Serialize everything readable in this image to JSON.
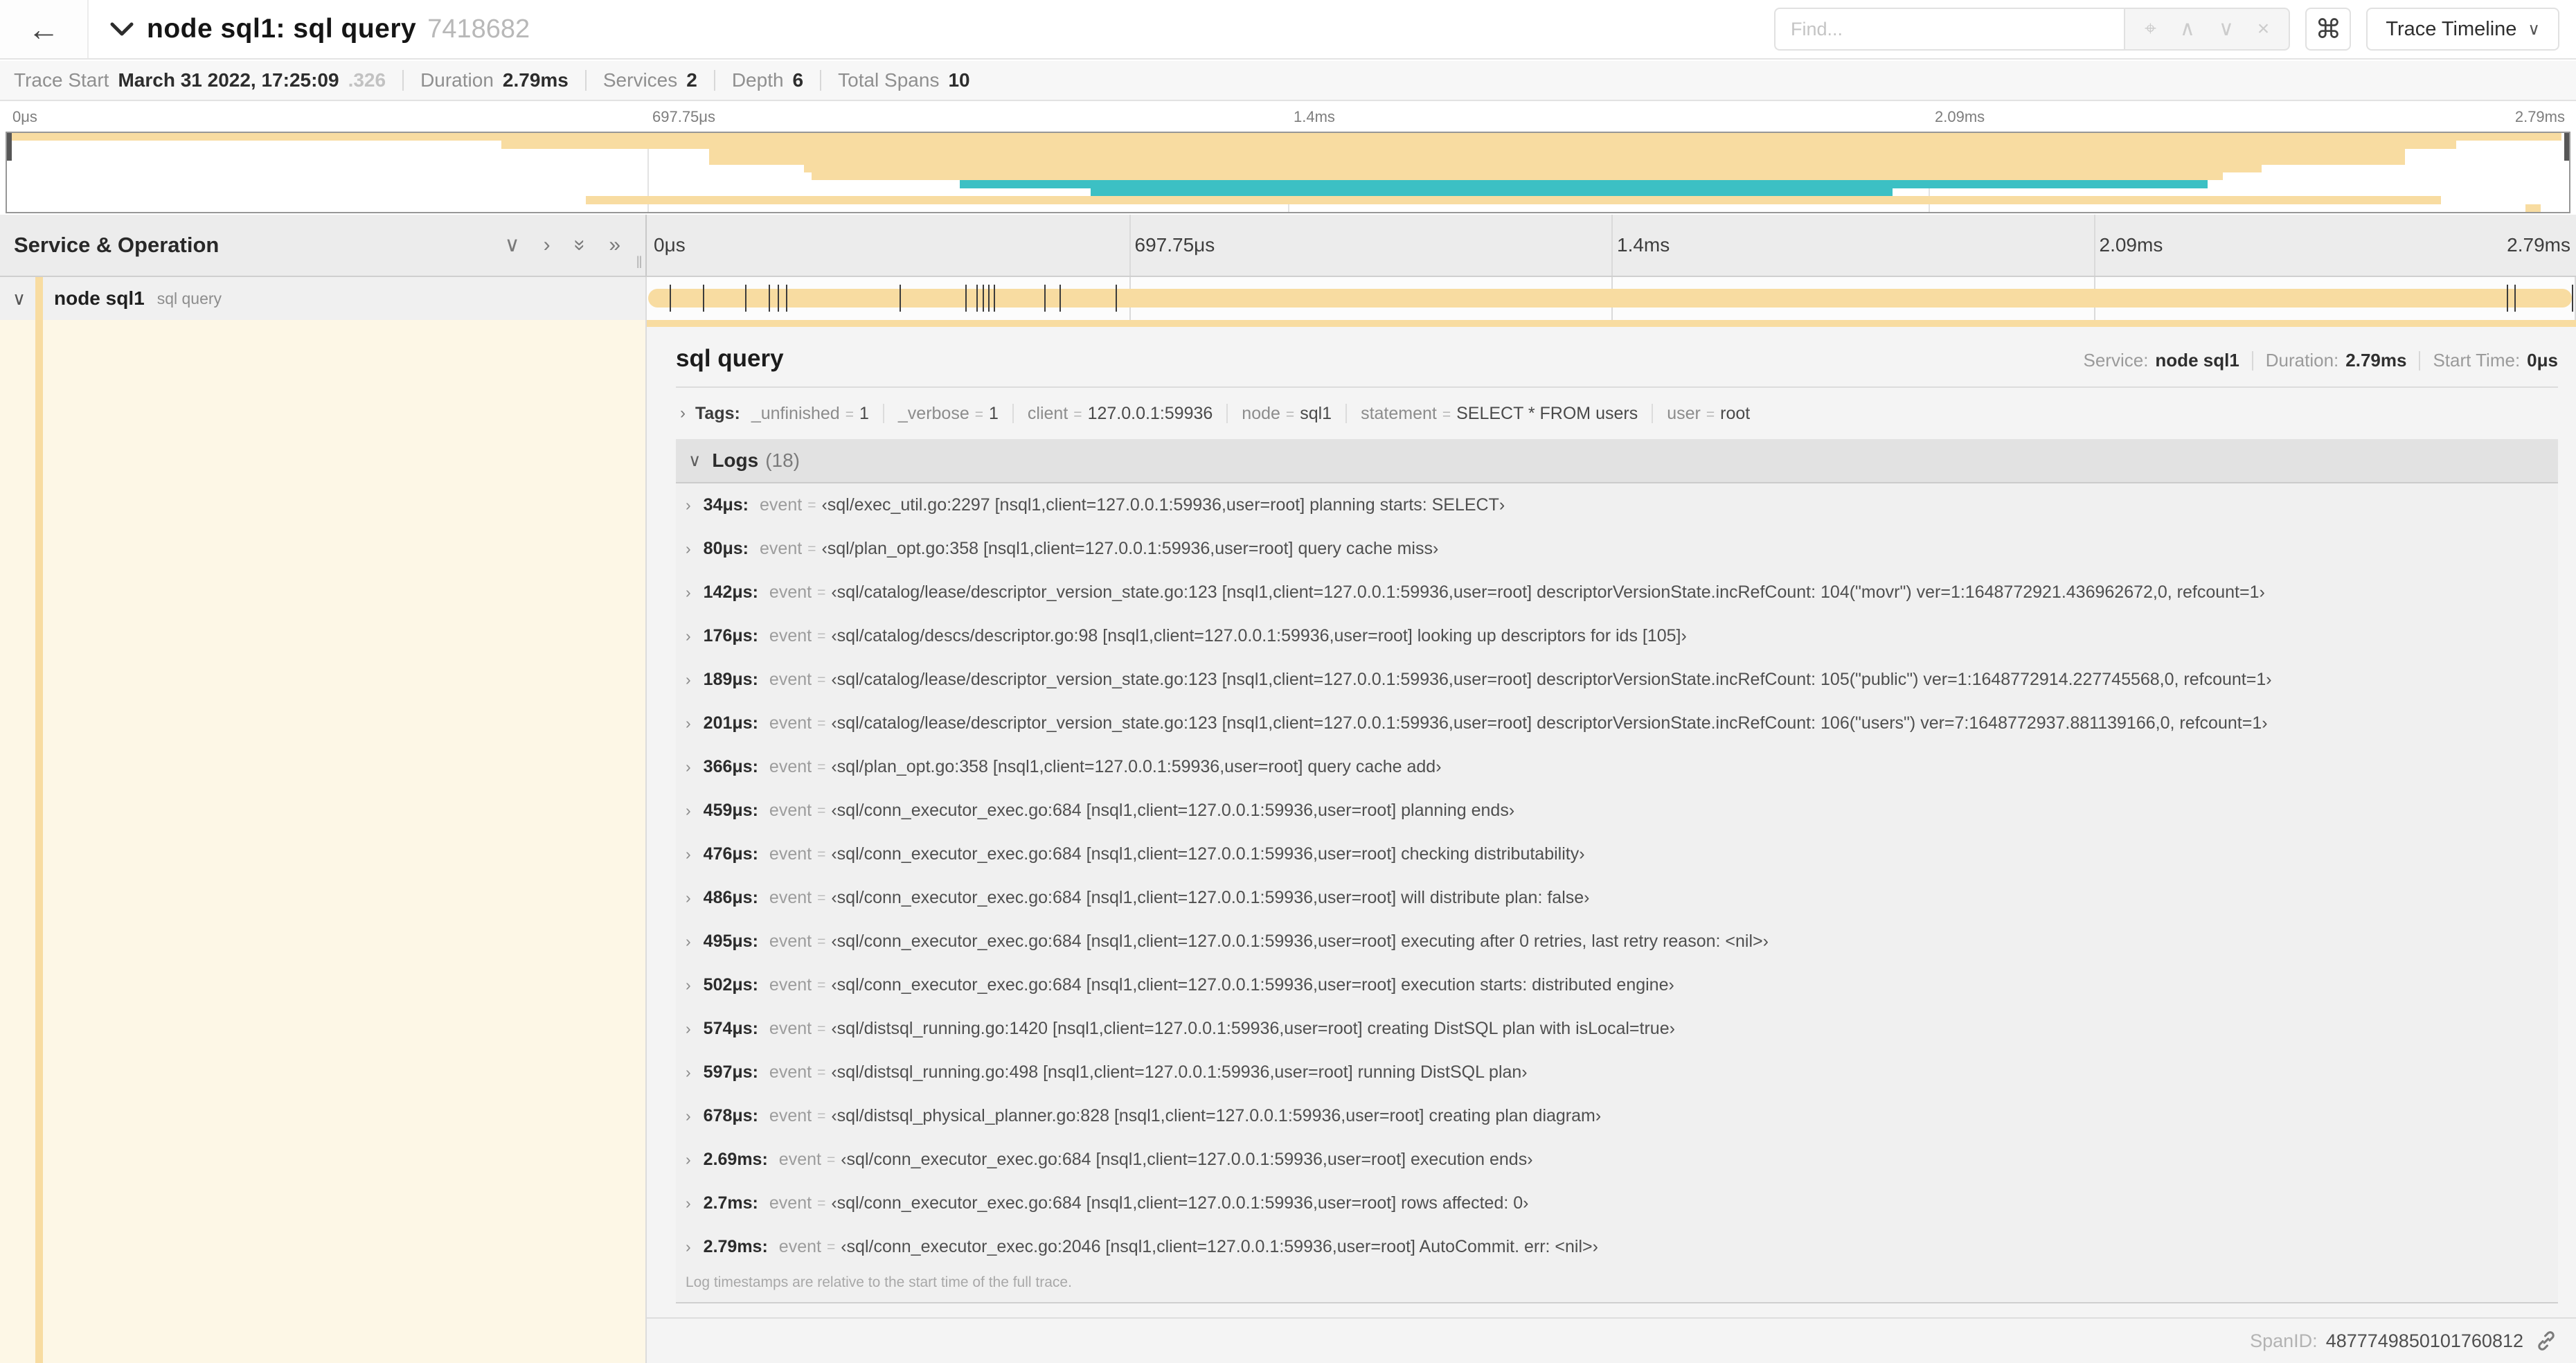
{
  "header": {
    "back_glyph": "←",
    "title": "node sql1: sql query",
    "trace_id": "7418682",
    "find_placeholder": "Find...",
    "find_icons": [
      {
        "name": "locate-icon",
        "glyph": "⌖"
      },
      {
        "name": "prev-match-icon",
        "glyph": "∧"
      },
      {
        "name": "next-match-icon",
        "glyph": "∨"
      },
      {
        "name": "clear-find-icon",
        "glyph": "×"
      }
    ],
    "shortcut_glyph": "⌘",
    "view_button_label": "Trace Timeline",
    "view_button_caret": "∨"
  },
  "summary": {
    "items": [
      {
        "label": "Trace Start",
        "value": "March 31 2022, 17:25:09",
        "suffix": ".326"
      },
      {
        "label": "Duration",
        "value": "2.79ms"
      },
      {
        "label": "Services",
        "value": "2"
      },
      {
        "label": "Depth",
        "value": "6"
      },
      {
        "label": "Total Spans",
        "value": "10"
      }
    ]
  },
  "colors": {
    "tan": "#F8DCA1",
    "teal": "#3CC0C4"
  },
  "minimap": {
    "ticks": [
      "0μs",
      "697.75μs",
      "1.4ms",
      "2.09ms",
      "2.79ms"
    ],
    "tick_pcts": [
      0,
      25,
      50,
      75,
      100
    ],
    "spans": [
      {
        "start": 0,
        "end": 99.7,
        "color": "tan"
      },
      {
        "start": 19.3,
        "end": 95.6,
        "color": "tan"
      },
      {
        "start": 27.4,
        "end": 93.6,
        "color": "tan"
      },
      {
        "start": 27.4,
        "end": 93.6,
        "color": "tan"
      },
      {
        "start": 31.1,
        "end": 88.0,
        "color": "tan"
      },
      {
        "start": 31.4,
        "end": 86.5,
        "color": "tan"
      },
      {
        "start": 37.2,
        "end": 85.9,
        "color": "teal"
      },
      {
        "start": 42.3,
        "end": 73.6,
        "color": "teal"
      },
      {
        "start": 22.6,
        "end": 95.0,
        "color": "tan"
      },
      {
        "start": 98.3,
        "end": 98.9,
        "color": "tan"
      }
    ]
  },
  "timeline": {
    "header_title": "Service & Operation",
    "header_icons": [
      {
        "name": "expand-one-icon",
        "glyph": "∨",
        "rot": false
      },
      {
        "name": "collapse-one-icon",
        "glyph": "›",
        "rot": false
      },
      {
        "name": "expand-all-icon",
        "glyph": "»",
        "rot": true
      },
      {
        "name": "collapse-all-icon",
        "glyph": "»",
        "rot": false
      }
    ],
    "resizer_glyph": "‖",
    "ticks": [
      "0μs",
      "697.75μs",
      "1.4ms",
      "2.09ms",
      "2.79ms"
    ],
    "tick_pcts": [
      0,
      25,
      50,
      75,
      100
    ],
    "row": {
      "service": "node sql1",
      "operation": "sql query",
      "chevron": "∨",
      "color": "tan"
    },
    "log_marker_pcts": [
      1.2,
      2.9,
      5.1,
      6.3,
      6.8,
      7.2,
      13.1,
      16.5,
      17.1,
      17.4,
      17.7,
      18.0,
      20.6,
      21.4,
      24.3,
      96.4,
      96.8,
      99.8
    ]
  },
  "detail": {
    "operation": "sql query",
    "meta": [
      {
        "label": "Service:",
        "value": "node sql1"
      },
      {
        "label": "Duration:",
        "value": "2.79ms"
      },
      {
        "label": "Start Time:",
        "value": "0μs"
      }
    ],
    "tags_label": "Tags:",
    "tags": [
      {
        "key": "_unfinished",
        "value": "1"
      },
      {
        "key": "_verbose",
        "value": "1"
      },
      {
        "key": "client",
        "value": "127.0.0.1:59936"
      },
      {
        "key": "node",
        "value": "sql1"
      },
      {
        "key": "statement",
        "value": "SELECT * FROM users"
      },
      {
        "key": "user",
        "value": "root"
      }
    ],
    "logs": {
      "title": "Logs",
      "count": "(18)",
      "field": "event",
      "entries": [
        {
          "time": "34μs",
          "value": "sql/exec_util.go:2297 [nsql1,client=127.0.0.1:59936,user=root] planning starts: SELECT"
        },
        {
          "time": "80μs",
          "value": "sql/plan_opt.go:358 [nsql1,client=127.0.0.1:59936,user=root] query cache miss"
        },
        {
          "time": "142μs",
          "value": "sql/catalog/lease/descriptor_version_state.go:123 [nsql1,client=127.0.0.1:59936,user=root] descriptorVersionState.incRefCount: 104(\"movr\") ver=1:1648772921.436962672,0, refcount=1"
        },
        {
          "time": "176μs",
          "value": "sql/catalog/descs/descriptor.go:98 [nsql1,client=127.0.0.1:59936,user=root] looking up descriptors for ids [105]"
        },
        {
          "time": "189μs",
          "value": "sql/catalog/lease/descriptor_version_state.go:123 [nsql1,client=127.0.0.1:59936,user=root] descriptorVersionState.incRefCount: 105(\"public\") ver=1:1648772914.227745568,0, refcount=1"
        },
        {
          "time": "201μs",
          "value": "sql/catalog/lease/descriptor_version_state.go:123 [nsql1,client=127.0.0.1:59936,user=root] descriptorVersionState.incRefCount: 106(\"users\") ver=7:1648772937.881139166,0, refcount=1"
        },
        {
          "time": "366μs",
          "value": "sql/plan_opt.go:358 [nsql1,client=127.0.0.1:59936,user=root] query cache add"
        },
        {
          "time": "459μs",
          "value": "sql/conn_executor_exec.go:684 [nsql1,client=127.0.0.1:59936,user=root] planning ends"
        },
        {
          "time": "476μs",
          "value": "sql/conn_executor_exec.go:684 [nsql1,client=127.0.0.1:59936,user=root] checking distributability"
        },
        {
          "time": "486μs",
          "value": "sql/conn_executor_exec.go:684 [nsql1,client=127.0.0.1:59936,user=root] will distribute plan: false"
        },
        {
          "time": "495μs",
          "value": "sql/conn_executor_exec.go:684 [nsql1,client=127.0.0.1:59936,user=root] executing after 0 retries, last retry reason: <nil>"
        },
        {
          "time": "502μs",
          "value": "sql/conn_executor_exec.go:684 [nsql1,client=127.0.0.1:59936,user=root] execution starts: distributed engine"
        },
        {
          "time": "574μs",
          "value": "sql/distsql_running.go:1420 [nsql1,client=127.0.0.1:59936,user=root] creating DistSQL plan with isLocal=true"
        },
        {
          "time": "597μs",
          "value": "sql/distsql_running.go:498 [nsql1,client=127.0.0.1:59936,user=root] running DistSQL plan"
        },
        {
          "time": "678μs",
          "value": "sql/distsql_physical_planner.go:828 [nsql1,client=127.0.0.1:59936,user=root] creating plan diagram"
        },
        {
          "time": "2.69ms",
          "value": "sql/conn_executor_exec.go:684 [nsql1,client=127.0.0.1:59936,user=root] execution ends"
        },
        {
          "time": "2.7ms",
          "value": "sql/conn_executor_exec.go:684 [nsql1,client=127.0.0.1:59936,user=root] rows affected: 0"
        },
        {
          "time": "2.79ms",
          "value": "sql/conn_executor_exec.go:2046 [nsql1,client=127.0.0.1:59936,user=root] AutoCommit. err: <nil>"
        }
      ],
      "footnote": "Log timestamps are relative to the start time of the full trace."
    },
    "span_id_label": "SpanID:",
    "span_id": "4877749850101760812"
  }
}
